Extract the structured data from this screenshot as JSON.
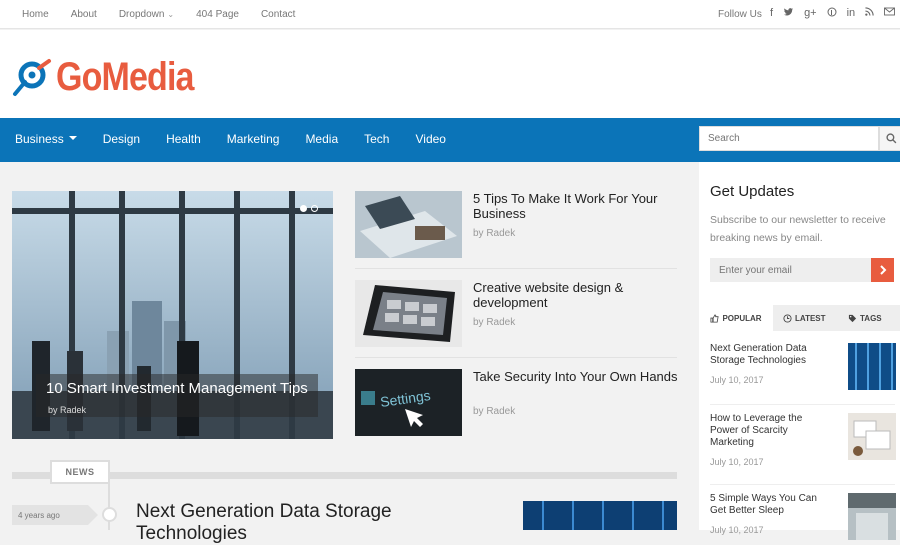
{
  "topbar": {
    "nav": [
      "Home",
      "About",
      "Dropdown",
      "404 Page",
      "Contact"
    ],
    "follow_label": "Follow Us",
    "social_icons": [
      "facebook-icon",
      "twitter-icon",
      "google-plus-icon",
      "pinterest-icon",
      "linkedin-icon",
      "rss-icon",
      "email-icon"
    ]
  },
  "logo": {
    "text": "GoMedia",
    "icon": "satellite-dish-icon",
    "colors": {
      "text": "#e85c3f",
      "icon": "#0b74b8"
    }
  },
  "mainnav": {
    "items": [
      "Business",
      "Design",
      "Health",
      "Marketing",
      "Media",
      "Tech",
      "Video"
    ],
    "color": "#0b74b8"
  },
  "search": {
    "placeholder": "Search",
    "icon": "search-icon"
  },
  "featured": {
    "title": "10 Smart Investment Management Tips",
    "author": "by Radek"
  },
  "posts": [
    {
      "title": "5 Tips To Make It Work For Your Business",
      "author": "by Radek"
    },
    {
      "title": "Creative website design & development",
      "author": "by Radek"
    },
    {
      "title": "Take Security Into Your Own Hands",
      "author": "by Radek",
      "thumb_text": "Settings"
    }
  ],
  "news": {
    "label": "NEWS",
    "time": "4 years ago",
    "title": "Next Generation Data Storage Technologies"
  },
  "sidebar": {
    "heading": "Get Updates",
    "description": "Subscribe to our newsletter to receive breaking news by email.",
    "email_placeholder": "Enter your email",
    "submit_icon": "chevron-right-icon",
    "accent": "#e85c3f",
    "tabs": [
      "POPULAR",
      "LATEST",
      "TAGS"
    ],
    "posts": [
      {
        "title": "Next Generation Data Storage Technologies",
        "date": "July 10, 2017"
      },
      {
        "title": "How to Leverage the Power of Scarcity Marketing",
        "date": "July 10, 2017"
      },
      {
        "title": "5 Simple Ways You Can Get Better Sleep",
        "date": "July 10, 2017"
      }
    ]
  }
}
